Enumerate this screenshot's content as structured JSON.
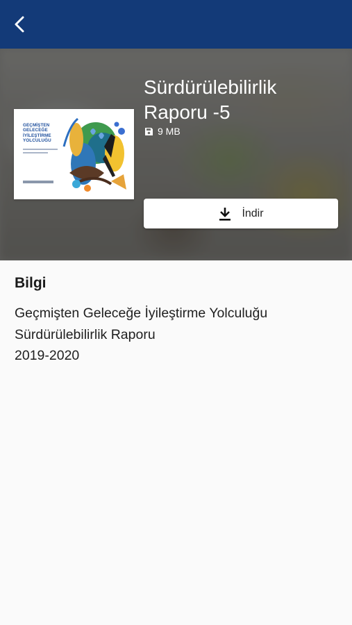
{
  "header": {
    "back_icon": "chevron-left-icon",
    "background_color": "#133a78"
  },
  "report": {
    "title": "Sürdürülebilirlik\nRaporu -5",
    "file_size": "9 MB",
    "file_size_icon": "save-disk-icon",
    "cover": {
      "title": "GEÇMİŞTEN\nGELECEĞE\nİYİLEŞTİRME\nYOLCULUĞU"
    }
  },
  "download": {
    "label": "İndir",
    "icon": "download-icon"
  },
  "info": {
    "heading": "Bilgi",
    "lines": [
      "Geçmişten Geleceğe İyileştirme Yolculuğu",
      "Sürdürülebilirlik Raporu",
      "2019-2020"
    ]
  }
}
